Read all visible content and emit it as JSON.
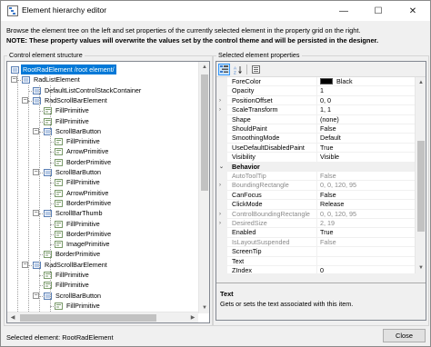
{
  "window": {
    "title": "Element hierarchy editor",
    "icon": "window-icon",
    "controls": {
      "minimize": "—",
      "maximize": "☐",
      "close": "✕"
    }
  },
  "intro": {
    "line1": "Browse the element tree on the left and set properties of the currently selected element in the property grid on the right.",
    "note_label": "NOTE:",
    "note_text": "These property values will overwrite the values set by the control theme and will be persisted in the designer."
  },
  "tree_panel": {
    "label": "Control element structure",
    "items": [
      {
        "label": "RootRadElement /root element/",
        "icon": "element-icon",
        "selected": true,
        "expander": "−"
      },
      {
        "label": "RadListElement",
        "icon": "element-icon",
        "expander": "−"
      },
      {
        "label": "DefaultListControlStackContainer",
        "icon": "element-icon"
      },
      {
        "label": "RadScrollBarElement",
        "icon": "element-icon",
        "expander": "−"
      },
      {
        "label": "FillPrimitive",
        "icon": "primitive-icon"
      },
      {
        "label": "FillPrimitive",
        "icon": "primitive-icon"
      },
      {
        "label": "ScrollBarButton",
        "icon": "element-icon",
        "expander": "−"
      },
      {
        "label": "FillPrimitive",
        "icon": "primitive-icon"
      },
      {
        "label": "ArrowPrimitive",
        "icon": "primitive-icon"
      },
      {
        "label": "BorderPrimitive",
        "icon": "primitive-icon"
      },
      {
        "label": "ScrollBarButton",
        "icon": "element-icon",
        "expander": "−"
      },
      {
        "label": "FillPrimitive",
        "icon": "primitive-icon"
      },
      {
        "label": "ArrowPrimitive",
        "icon": "primitive-icon"
      },
      {
        "label": "BorderPrimitive",
        "icon": "primitive-icon"
      },
      {
        "label": "ScrollBarThumb",
        "icon": "element-icon",
        "expander": "−"
      },
      {
        "label": "FillPrimitive",
        "icon": "primitive-icon"
      },
      {
        "label": "BorderPrimitive",
        "icon": "primitive-icon"
      },
      {
        "label": "ImagePrimitive",
        "icon": "primitive-icon"
      },
      {
        "label": "BorderPrimitive",
        "icon": "primitive-icon"
      },
      {
        "label": "RadScrollBarElement",
        "icon": "element-icon",
        "expander": "−"
      },
      {
        "label": "FillPrimitive",
        "icon": "primitive-icon"
      },
      {
        "label": "FillPrimitive",
        "icon": "primitive-icon"
      },
      {
        "label": "ScrollBarButton",
        "icon": "element-icon",
        "expander": "−"
      },
      {
        "label": "FillPrimitive",
        "icon": "primitive-icon"
      },
      {
        "label": "ArrowPrimitive",
        "icon": "primitive-icon"
      },
      {
        "label": "BorderPrimitive",
        "icon": "primitive-icon"
      }
    ]
  },
  "properties_panel": {
    "label": "Selected element properties",
    "toolbar": {
      "categorized": "categorized-icon",
      "alphabetical": "alphabetical-icon",
      "pages": "property-pages-icon"
    },
    "rows": [
      {
        "name": "ForeColor",
        "value": "Black",
        "swatch": "#000000"
      },
      {
        "name": "Opacity",
        "value": "1"
      },
      {
        "name": "PositionOffset",
        "value": "0, 0",
        "caret": "›"
      },
      {
        "name": "ScaleTransform",
        "value": "1, 1",
        "caret": "›"
      },
      {
        "name": "Shape",
        "value": "(none)"
      },
      {
        "name": "ShouldPaint",
        "value": "False"
      },
      {
        "name": "SmoothingMode",
        "value": "Default"
      },
      {
        "name": "UseDefaultDisabledPaint",
        "value": "True"
      },
      {
        "name": "Visibility",
        "value": "Visible"
      },
      {
        "name": "Behavior",
        "category": true,
        "caret": "⌄"
      },
      {
        "name": "AutoToolTip",
        "value": "False",
        "dim": true
      },
      {
        "name": "BoundingRectangle",
        "value": "0, 0, 120, 95",
        "dim": true,
        "caret": "›"
      },
      {
        "name": "CanFocus",
        "value": "False"
      },
      {
        "name": "ClickMode",
        "value": "Release"
      },
      {
        "name": "ControlBoundingRectangle",
        "value": "0, 0, 120, 95",
        "dim": true,
        "caret": "›"
      },
      {
        "name": "DesiredSize",
        "value": "2, 19",
        "dim": true,
        "caret": "›"
      },
      {
        "name": "Enabled",
        "value": "True"
      },
      {
        "name": "IsLayoutSuspended",
        "value": "False",
        "dim": true
      },
      {
        "name": "ScreenTip",
        "value": ""
      },
      {
        "name": "Text",
        "value": ""
      },
      {
        "name": "ZIndex",
        "value": "0"
      }
    ],
    "description": {
      "title": "Text",
      "text": "Gets or sets the text associated with this item."
    }
  },
  "footer": {
    "status": "Selected element: RootRadElement",
    "close_button": "Close"
  }
}
